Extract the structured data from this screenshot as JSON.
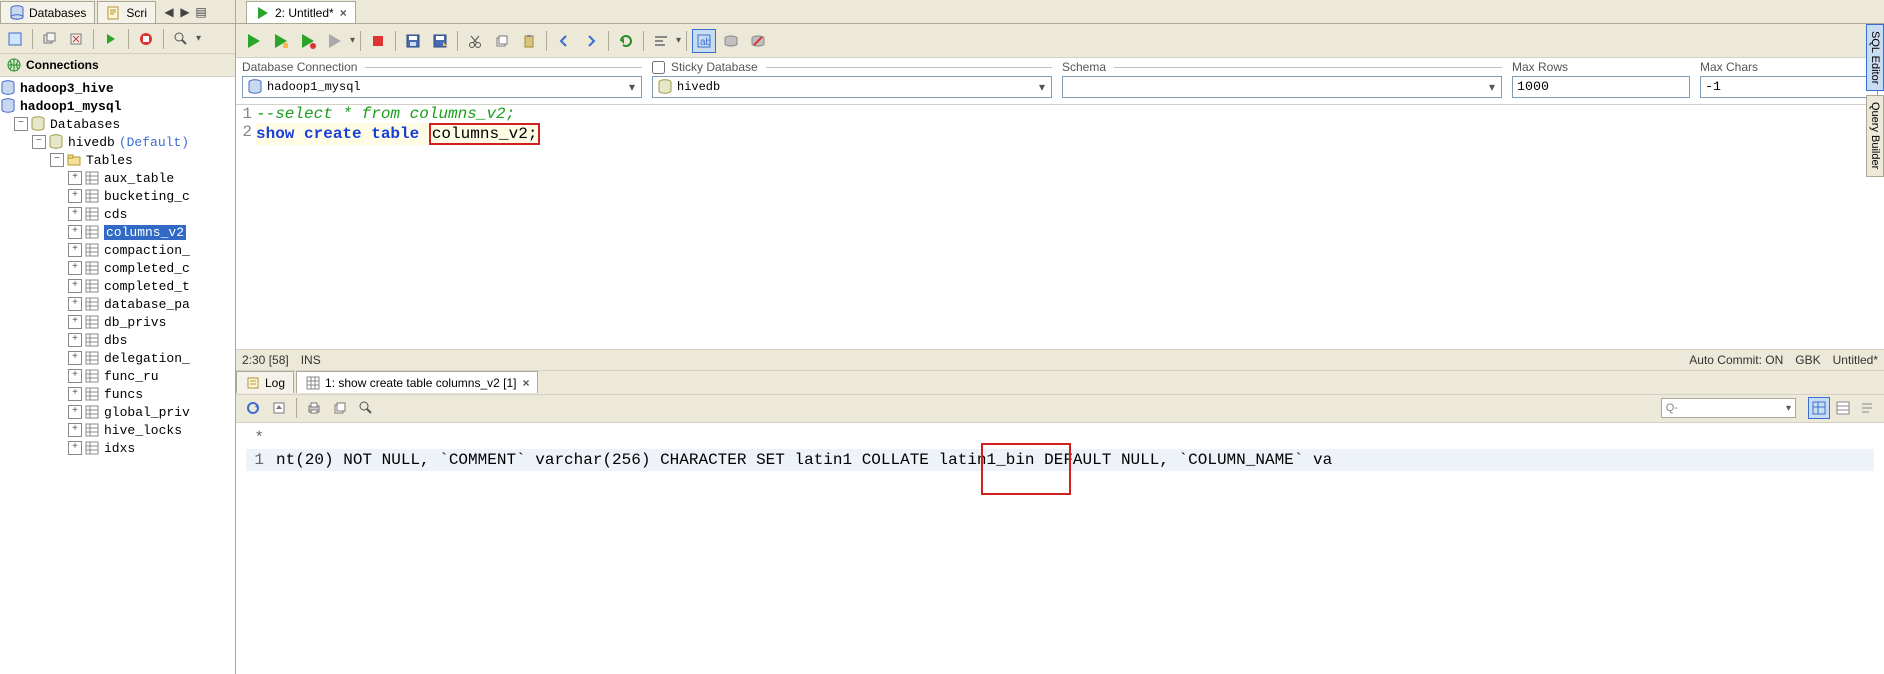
{
  "left_tabs": {
    "databases": "Databases",
    "scripts": "Scri"
  },
  "right_tab": {
    "label": "2: Untitled*"
  },
  "connections_header": "Connections",
  "tree": {
    "conn1": "hadoop3_hive",
    "conn2": "hadoop1_mysql",
    "databases_node": "Databases",
    "hivedb": "hivedb",
    "hivedb_default": "(Default)",
    "tables_node": "Tables",
    "tables": [
      "aux_table",
      "bucketing_c",
      "cds",
      "columns_v2",
      "compaction_",
      "completed_c",
      "completed_t",
      "database_pa",
      "db_privs",
      "dbs",
      "delegation_",
      "func_ru",
      "funcs",
      "global_priv",
      "hive_locks",
      "idxs"
    ]
  },
  "conn_row": {
    "db_label": "Database Connection",
    "db_value": "hadoop1_mysql",
    "sticky_label": "Sticky Database",
    "sticky_value": "hivedb",
    "schema_label": "Schema",
    "maxrows_label": "Max Rows",
    "maxrows_value": "1000",
    "maxchars_label": "Max Chars",
    "maxchars_value": "-1"
  },
  "editor": {
    "line1_num": "1",
    "line1_text": "--select * from columns_v2;",
    "line2_num": "2",
    "line2_kw": "show create table ",
    "line2_ident": "columns_v2;"
  },
  "status": {
    "left1": "2:30 [58]",
    "left2": "INS",
    "right1": "Auto Commit: ON",
    "right2": "GBK",
    "right3": "Untitled*"
  },
  "result_tabs": {
    "log": "Log",
    "result1": "1: show create table columns_v2 [1]"
  },
  "result_search_placeholder": "",
  "result": {
    "star": "*",
    "row1_num": "1",
    "row1_text": "nt(20) NOT NULL,  `COMMENT` varchar(256) CHARACTER SET latin1 COLLATE latin1_bin DEFAULT NULL,  `COLUMN_NAME` va"
  },
  "side": {
    "sql_editor": "SQL Editor",
    "query_builder": "Query Builder"
  },
  "search_prefix": "Q-"
}
